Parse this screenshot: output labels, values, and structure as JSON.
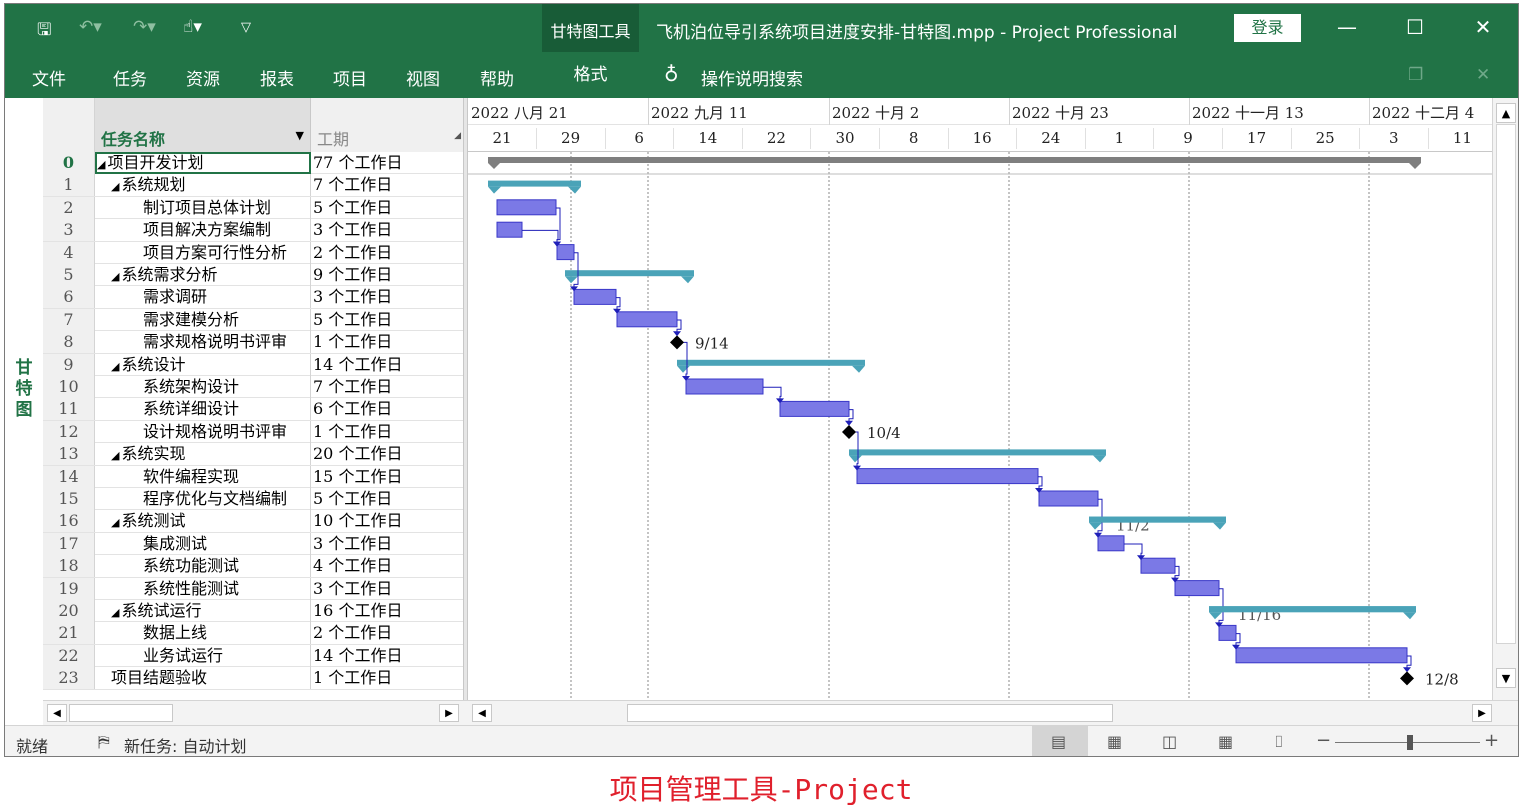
{
  "titlebar": {
    "context_tab": "甘特图工具",
    "document_title": "飞机泊位导引系统项目进度安排-甘特图.mpp  -  Project Professional",
    "login_label": "登录",
    "minimize": "—",
    "maximize": "☐",
    "close": "✕"
  },
  "menu": {
    "file": "文件",
    "task": "任务",
    "resource": "资源",
    "report": "报表",
    "project": "项目",
    "view": "视图",
    "help": "帮助",
    "format": "格式",
    "search": "操作说明搜索"
  },
  "side_label": "甘特图",
  "columns": {
    "name": "任务名称",
    "duration": "工期"
  },
  "rows": [
    {
      "id": "0",
      "name": "项目开发计划",
      "duration": "77 个工作日",
      "indent": 0,
      "summary": true
    },
    {
      "id": "1",
      "name": "系统规划",
      "duration": "7 个工作日",
      "indent": 1,
      "summary": true
    },
    {
      "id": "2",
      "name": "制订项目总体计划",
      "duration": "5 个工作日",
      "indent": 2
    },
    {
      "id": "3",
      "name": "项目解决方案编制",
      "duration": "3 个工作日",
      "indent": 2
    },
    {
      "id": "4",
      "name": "项目方案可行性分析",
      "duration": "2 个工作日",
      "indent": 2
    },
    {
      "id": "5",
      "name": "系统需求分析",
      "duration": "9 个工作日",
      "indent": 1,
      "summary": true
    },
    {
      "id": "6",
      "name": "需求调研",
      "duration": "3 个工作日",
      "indent": 2
    },
    {
      "id": "7",
      "name": "需求建模分析",
      "duration": "5 个工作日",
      "indent": 2
    },
    {
      "id": "8",
      "name": "需求规格说明书评审",
      "duration": "1 个工作日",
      "indent": 2
    },
    {
      "id": "9",
      "name": "系统设计",
      "duration": "14 个工作日",
      "indent": 1,
      "summary": true
    },
    {
      "id": "10",
      "name": "系统架构设计",
      "duration": "7 个工作日",
      "indent": 2
    },
    {
      "id": "11",
      "name": "系统详细设计",
      "duration": "6 个工作日",
      "indent": 2
    },
    {
      "id": "12",
      "name": "设计规格说明书评审",
      "duration": "1 个工作日",
      "indent": 2
    },
    {
      "id": "13",
      "name": "系统实现",
      "duration": "20 个工作日",
      "indent": 1,
      "summary": true
    },
    {
      "id": "14",
      "name": "软件编程实现",
      "duration": "15 个工作日",
      "indent": 2
    },
    {
      "id": "15",
      "name": "程序优化与文档编制",
      "duration": "5 个工作日",
      "indent": 2
    },
    {
      "id": "16",
      "name": "系统测试",
      "duration": "10 个工作日",
      "indent": 1,
      "summary": true
    },
    {
      "id": "17",
      "name": "集成测试",
      "duration": "3 个工作日",
      "indent": 2
    },
    {
      "id": "18",
      "name": "系统功能测试",
      "duration": "4 个工作日",
      "indent": 2
    },
    {
      "id": "19",
      "name": "系统性能测试",
      "duration": "3 个工作日",
      "indent": 2
    },
    {
      "id": "20",
      "name": "系统试运行",
      "duration": "16 个工作日",
      "indent": 1,
      "summary": true
    },
    {
      "id": "21",
      "name": "数据上线",
      "duration": "2 个工作日",
      "indent": 2
    },
    {
      "id": "22",
      "name": "业务试运行",
      "duration": "14 个工作日",
      "indent": 2
    },
    {
      "id": "23",
      "name": "项目结题验收",
      "duration": "1 个工作日",
      "indent": 1
    }
  ],
  "timescale": {
    "top": [
      "2022 八月 21",
      "2022 九月 11",
      "2022 十月 2",
      "2022 十月 23",
      "2022 十一月 13",
      "2022 十二月 4"
    ],
    "bottom": [
      "21",
      "29",
      "6",
      "14",
      "22",
      "30",
      "8",
      "16",
      "24",
      "1",
      "9",
      "17",
      "25",
      "3",
      "11"
    ]
  },
  "milestones": [
    {
      "row": 8,
      "label": "9/14"
    },
    {
      "row": 12,
      "label": "10/4"
    },
    {
      "row": 23,
      "label": "12/8"
    }
  ],
  "clipped_labels": [
    {
      "row": 16,
      "label": "11/2"
    },
    {
      "row": 20,
      "label": "11/16"
    }
  ],
  "status": {
    "ready": "就绪",
    "new_task": "新任务: 自动计划"
  },
  "caption": "项目管理工具-Project",
  "colors": {
    "ribbon": "#217346",
    "context_tab": "#185c37",
    "summary_bar": "#4aa3b8",
    "project_summary": "#7f7f7f",
    "task_bar": "#7b79e6",
    "task_border": "#3a38c8",
    "link": "#1f1fb8",
    "caption": "#e0202c"
  }
}
